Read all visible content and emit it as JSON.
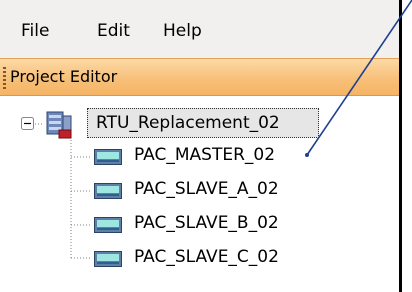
{
  "menu": {
    "file": "File",
    "edit": "Edit",
    "help": "Help"
  },
  "panel": {
    "title": "Project Editor"
  },
  "tree": {
    "root": {
      "label": "RTU_Replacement_02",
      "icon": "server-rack-icon",
      "expanded": true,
      "selected": true
    },
    "children": [
      {
        "label": "PAC_MASTER_02",
        "icon": "controller-module-icon"
      },
      {
        "label": "PAC_SLAVE_A_02",
        "icon": "controller-module-icon"
      },
      {
        "label": "PAC_SLAVE_B_02",
        "icon": "controller-module-icon"
      },
      {
        "label": "PAC_SLAVE_C_02",
        "icon": "controller-module-icon"
      }
    ]
  },
  "colors": {
    "panel_header": "#f7c07a",
    "annotation_line": "#1f3f8f",
    "selection": "#e6e6e6"
  }
}
